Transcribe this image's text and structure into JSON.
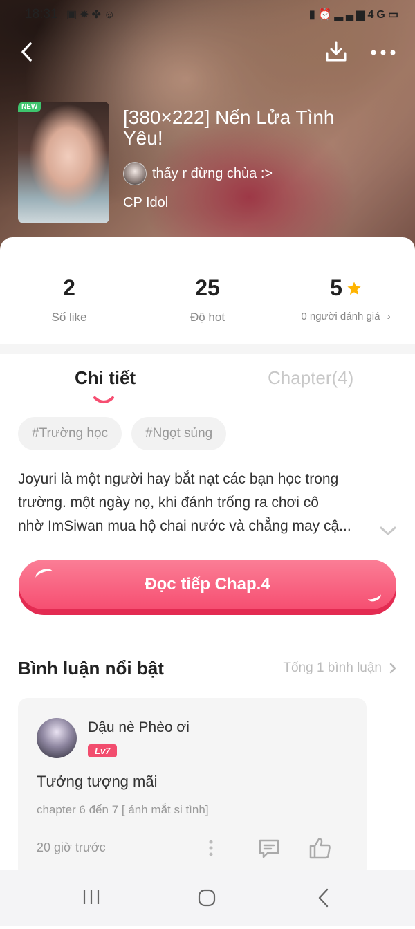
{
  "status_bar": {
    "time": "18:31",
    "left_icons": [
      "image-icon",
      "bug-icon",
      "clover-icon",
      "emoji-icon"
    ],
    "right_icons": [
      "battery-saver-icon",
      "alarm-icon",
      "signal-icon",
      "network-icon",
      "battery-icon"
    ],
    "network": "4G"
  },
  "header": {
    "cover_badge": "NEW",
    "title": "[380×222] Nến Lửa Tình Yêu!",
    "author": "thấy r đừng chùa :>",
    "category": "CP Idol"
  },
  "stats": [
    {
      "value": "2",
      "label": "Số like"
    },
    {
      "value": "25",
      "label": "Độ hot"
    },
    {
      "value": "5",
      "label": "0 người đánh giá"
    }
  ],
  "tabs": {
    "detail": "Chi tiết",
    "chapter": "Chapter(4)",
    "active": "detail"
  },
  "tags": [
    "#Trường học",
    "#Ngọt sủng"
  ],
  "description": [
    "Joyuri là một người hay bắt nạt các bạn học trong",
    "trường. một ngày nọ, khi đánh trống ra chơi cô",
    "nhờ ImSiwan mua hộ chai nước và chẳng may cậ..."
  ],
  "read_button": "Đọc tiếp Chap.4",
  "comments": {
    "title": "Bình luận nổi bật",
    "total": "Tổng 1 bình luận",
    "items": [
      {
        "user": "Dậu nè Phèo ơi",
        "level": "Lv7",
        "text": "Tưởng tượng mãi",
        "chapter": "chapter 6 đến 7 [ ánh mắt si tình]",
        "time": "20 giờ trước"
      }
    ]
  },
  "colors": {
    "accent": "#f64e71",
    "accent_dark": "#e32b52",
    "star": "#ffb400",
    "muted": "#999999"
  }
}
